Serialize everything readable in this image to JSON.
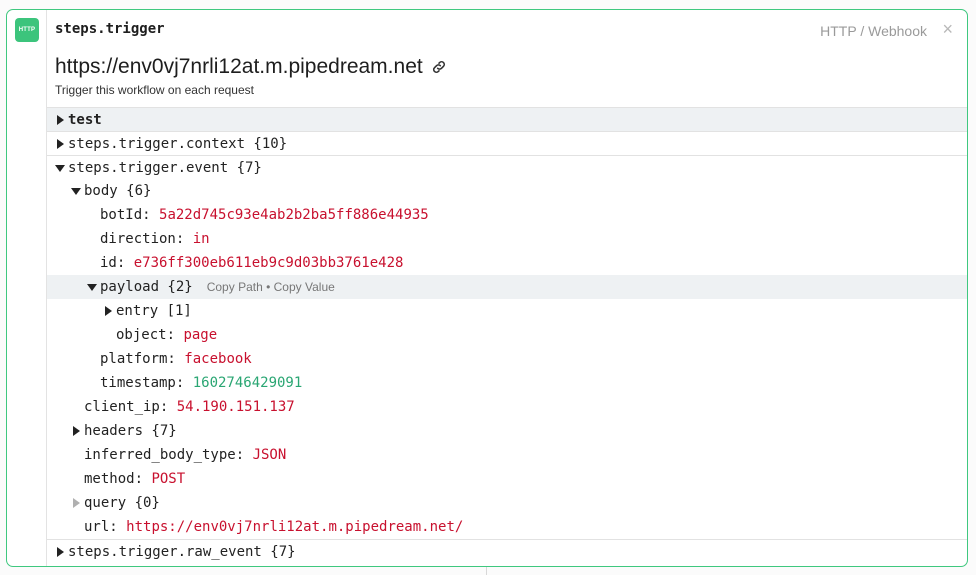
{
  "step": {
    "name": "steps.trigger",
    "type_label": "HTTP / Webhook",
    "badge": "HTTP",
    "close": "×",
    "endpoint_url": "https://env0vj7nrli12at.m.pipedream.net",
    "subtitle": "Trigger this workflow on each request"
  },
  "tree": {
    "test": "test",
    "context": "steps.trigger.context {10}",
    "event": "steps.trigger.event {7}",
    "body": "body {6}",
    "botId_key": "botId: ",
    "botId_val": "5a22d745c93e4ab2b2ba5ff886e44935",
    "direction_key": "direction: ",
    "direction_val": "in",
    "id_key": "id: ",
    "id_val": "e736ff300eb611eb9c9d03bb3761e428",
    "payload": "payload {2}",
    "copy_path": "Copy Path",
    "copy_sep": " • ",
    "copy_value": "Copy Value",
    "entry": "entry [1]",
    "object_key": "object: ",
    "object_val": "page",
    "platform_key": "platform: ",
    "platform_val": "facebook",
    "timestamp_key": "timestamp: ",
    "timestamp_val": "1602746429091",
    "client_ip_key": "client_ip: ",
    "client_ip_val": "54.190.151.137",
    "headers": "headers {7}",
    "inferred_key": "inferred_body_type: ",
    "inferred_val": "JSON",
    "method_key": "method: ",
    "method_val": "POST",
    "query": "query {0}",
    "url_key": "url: ",
    "url_val": "https://env0vj7nrli12at.m.pipedream.net/",
    "raw_event": "steps.trigger.raw_event {7}"
  },
  "colors": {
    "accent": "#3cc47c",
    "string_value": "#c8102e",
    "number_value": "#2aa673"
  }
}
